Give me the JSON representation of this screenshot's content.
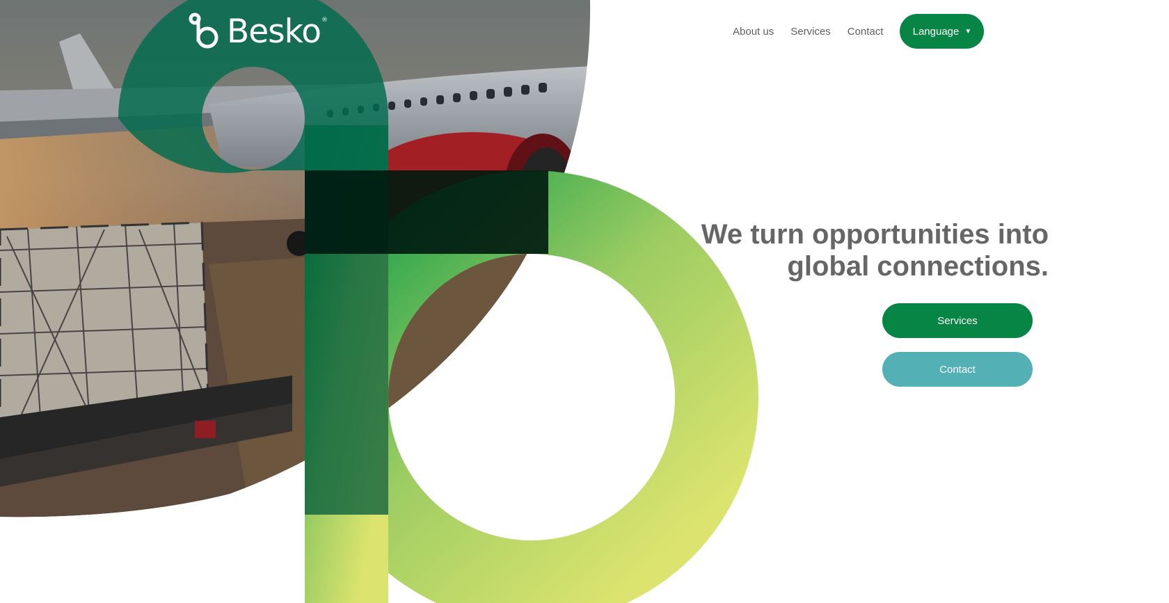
{
  "brand": {
    "name": "Besko",
    "registered": "®"
  },
  "nav": {
    "items": [
      "About us",
      "Services",
      "Contact"
    ],
    "language_label": "Language",
    "language_caret": "▼"
  },
  "hero": {
    "headline_line1": "We turn opportunities into",
    "headline_line2": "global connections.",
    "image_subject": "cargo airplane being loaded with netted pallets at an airport apron at sunset"
  },
  "cta": {
    "services_label": "Services",
    "contact_label": "Contact"
  },
  "colors": {
    "brand_green": "#078545",
    "teal": "#53b0b5",
    "dark_green_overlay": "#006b4d",
    "ring_gradient_start": "#2aa54d",
    "ring_gradient_end": "#dce46f",
    "text_gray": "#666666"
  }
}
